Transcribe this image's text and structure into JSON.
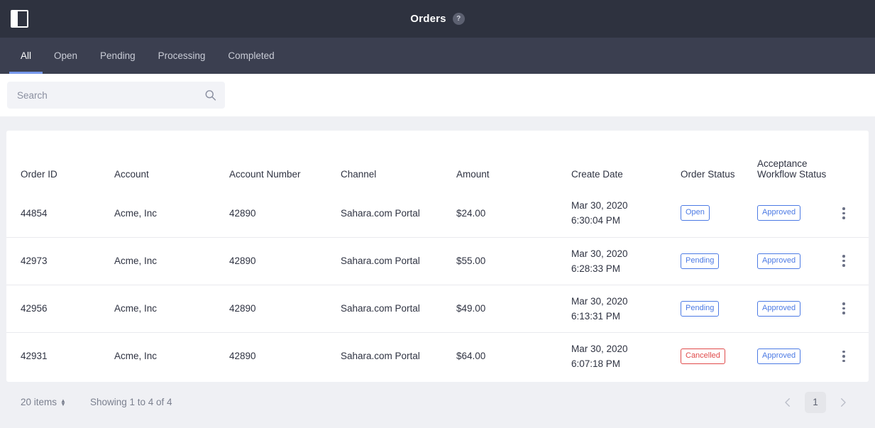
{
  "header": {
    "panel_toggle_icon": "sidebar-panel-icon",
    "title": "Orders",
    "help_icon_label": "?"
  },
  "tabs": [
    {
      "label": "All",
      "active": true
    },
    {
      "label": "Open",
      "active": false
    },
    {
      "label": "Pending",
      "active": false
    },
    {
      "label": "Processing",
      "active": false
    },
    {
      "label": "Completed",
      "active": false
    }
  ],
  "search": {
    "value": "",
    "placeholder": "Search",
    "icon": "search-icon"
  },
  "table": {
    "columns": [
      "Order ID",
      "Account",
      "Account Number",
      "Channel",
      "Amount",
      "Create Date",
      "Order Status",
      "Acceptance Workflow Status"
    ],
    "rows": [
      {
        "order_id": "44854",
        "account": "Acme, Inc",
        "account_number": "42890",
        "channel": "Sahara.com Portal",
        "amount": "$24.00",
        "create_date_line1": "Mar 30, 2020",
        "create_date_line2": "6:30:04 PM",
        "order_status": "Open",
        "order_status_type": "info",
        "workflow_status": "Approved",
        "workflow_status_type": "info"
      },
      {
        "order_id": "42973",
        "account": "Acme, Inc",
        "account_number": "42890",
        "channel": "Sahara.com Portal",
        "amount": "$55.00",
        "create_date_line1": "Mar 30, 2020",
        "create_date_line2": "6:28:33 PM",
        "order_status": "Pending",
        "order_status_type": "info",
        "workflow_status": "Approved",
        "workflow_status_type": "info"
      },
      {
        "order_id": "42956",
        "account": "Acme, Inc",
        "account_number": "42890",
        "channel": "Sahara.com Portal",
        "amount": "$49.00",
        "create_date_line1": "Mar 30, 2020",
        "create_date_line2": "6:13:31 PM",
        "order_status": "Pending",
        "order_status_type": "info",
        "workflow_status": "Approved",
        "workflow_status_type": "info"
      },
      {
        "order_id": "42931",
        "account": "Acme, Inc",
        "account_number": "42890",
        "channel": "Sahara.com Portal",
        "amount": "$64.00",
        "create_date_line1": "Mar 30, 2020",
        "create_date_line2": "6:07:18 PM",
        "order_status": "Cancelled",
        "order_status_type": "danger",
        "workflow_status": "Approved",
        "workflow_status_type": "info"
      }
    ]
  },
  "footer": {
    "items_count": "20 items",
    "showing": "Showing 1 to 4 of 4",
    "prev_icon": "chevron-left-icon",
    "next_icon": "chevron-right-icon",
    "current_page": "1"
  },
  "colors": {
    "header_bg": "#2e323f",
    "tabbar_bg": "#3b3f50",
    "page_bg": "#eff0f4",
    "accent": "#7698ec",
    "badge_info": "#4c7ae4",
    "badge_danger": "#e04a4a"
  }
}
